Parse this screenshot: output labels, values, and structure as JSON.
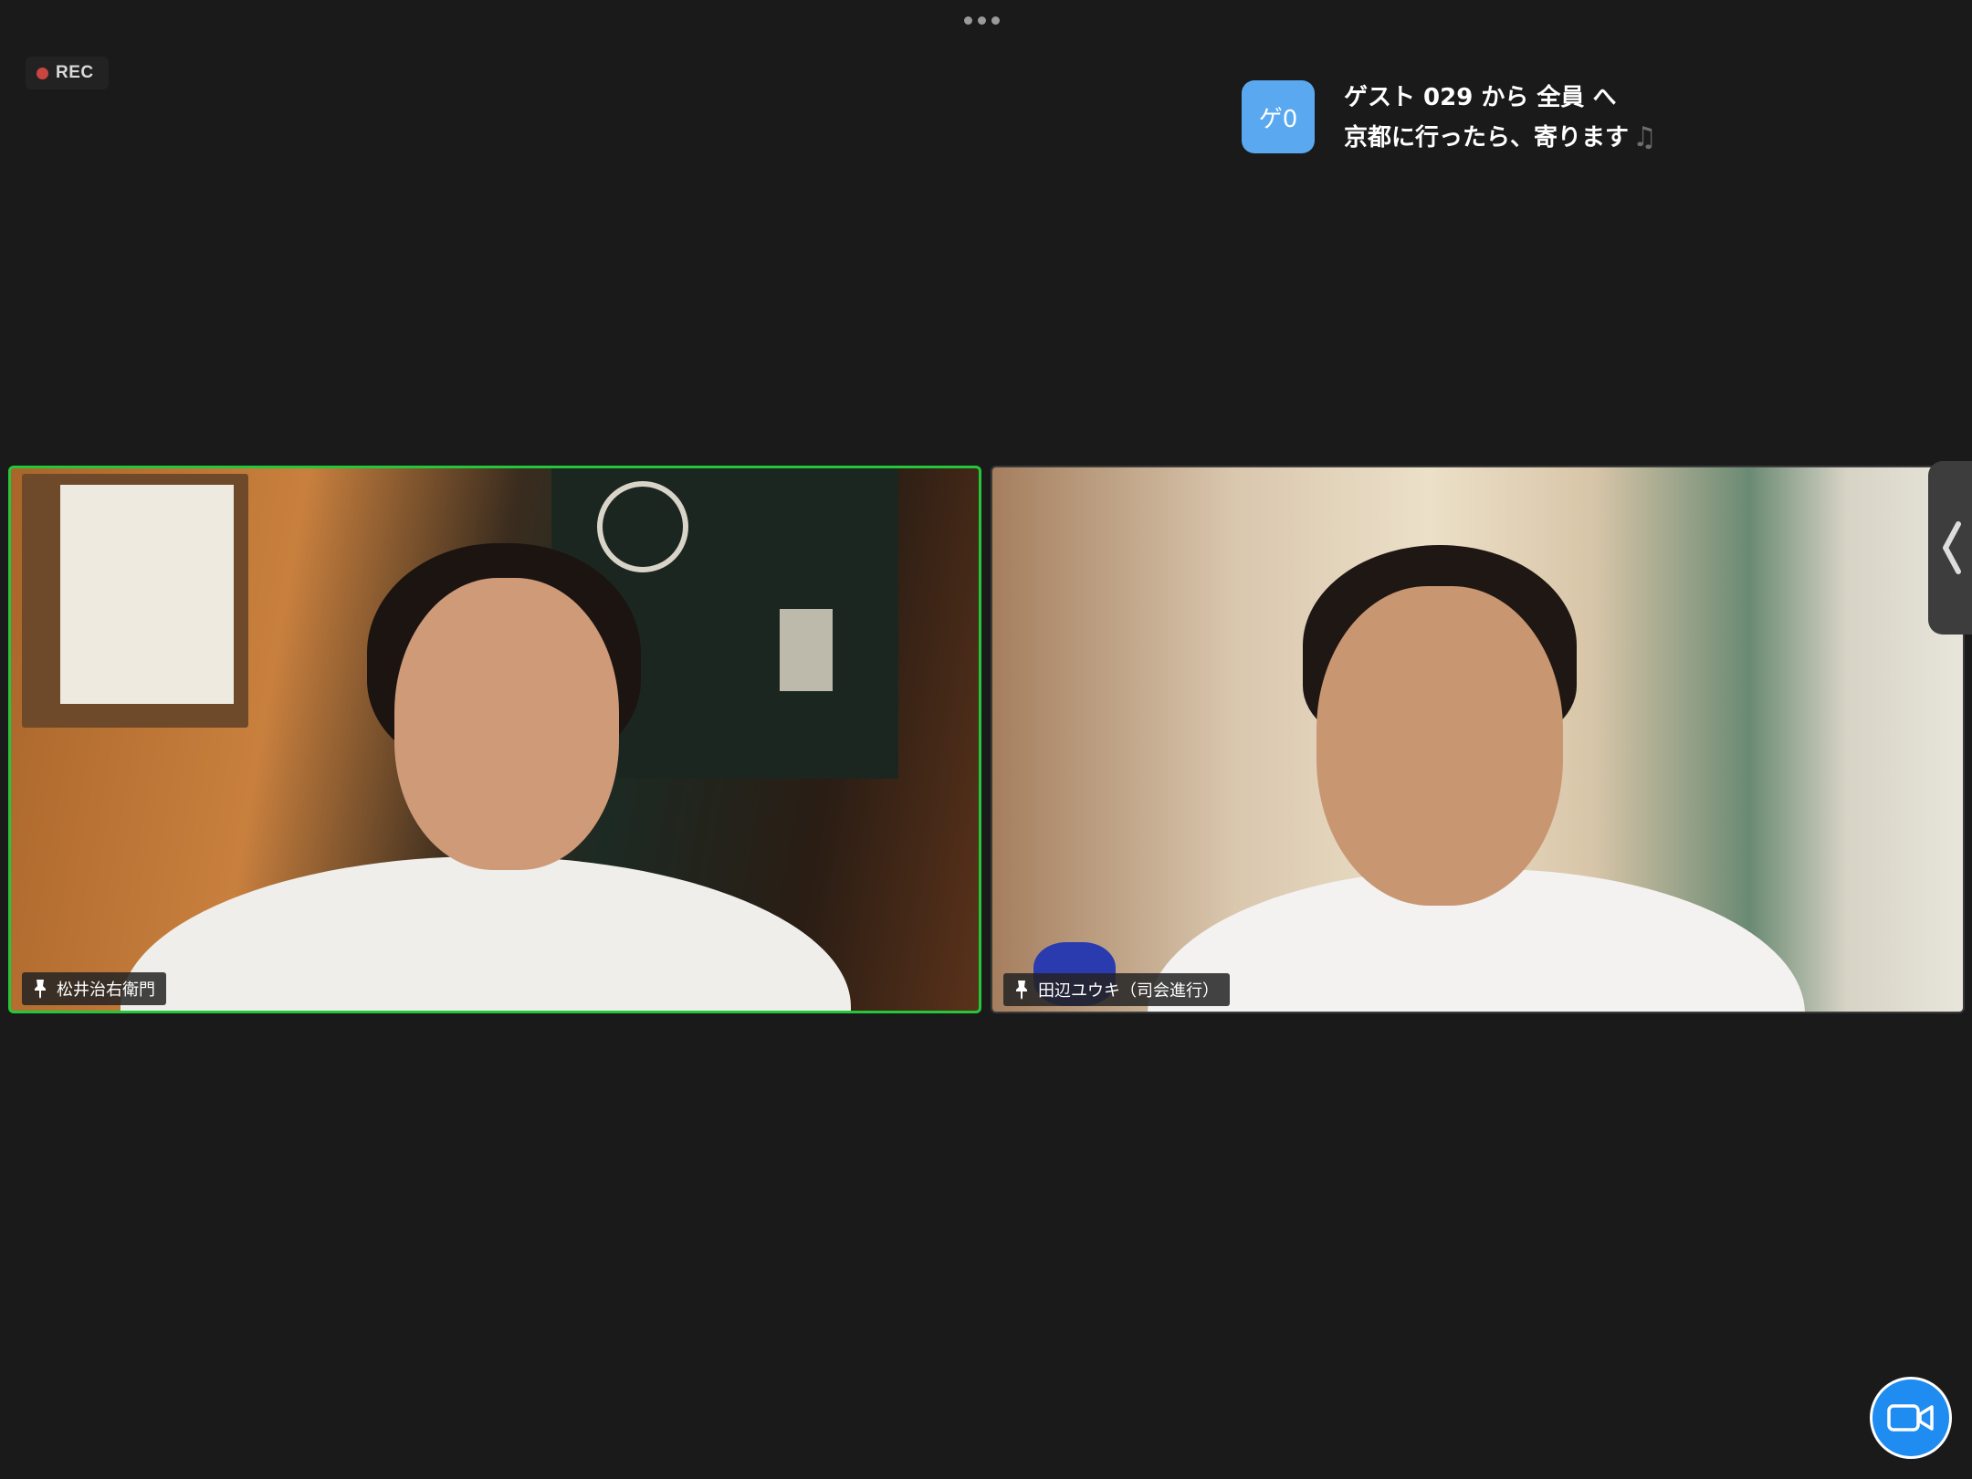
{
  "header": {
    "more_icon": "more-horizontal-icon"
  },
  "recording": {
    "label": "REC",
    "dot_color": "#c9453f"
  },
  "chat": {
    "avatar_initials": "ゲ0",
    "avatar_color": "#5aa9f0",
    "header": "ゲスト 029 から 全員 へ",
    "message": "京都に行ったら、寄ります",
    "message_icon": "music-note-icon"
  },
  "participants": [
    {
      "name": "松井治右衛門",
      "pinned": true,
      "active_speaker": true,
      "border_color": "#25c73a"
    },
    {
      "name": "田辺ユウキ（司会進行）",
      "pinned": true,
      "active_speaker": false
    }
  ],
  "controls": {
    "side_panel_icon": "chevron-left-icon",
    "camera_icon": "video-camera-icon",
    "camera_button_color": "#1e8cf0"
  }
}
